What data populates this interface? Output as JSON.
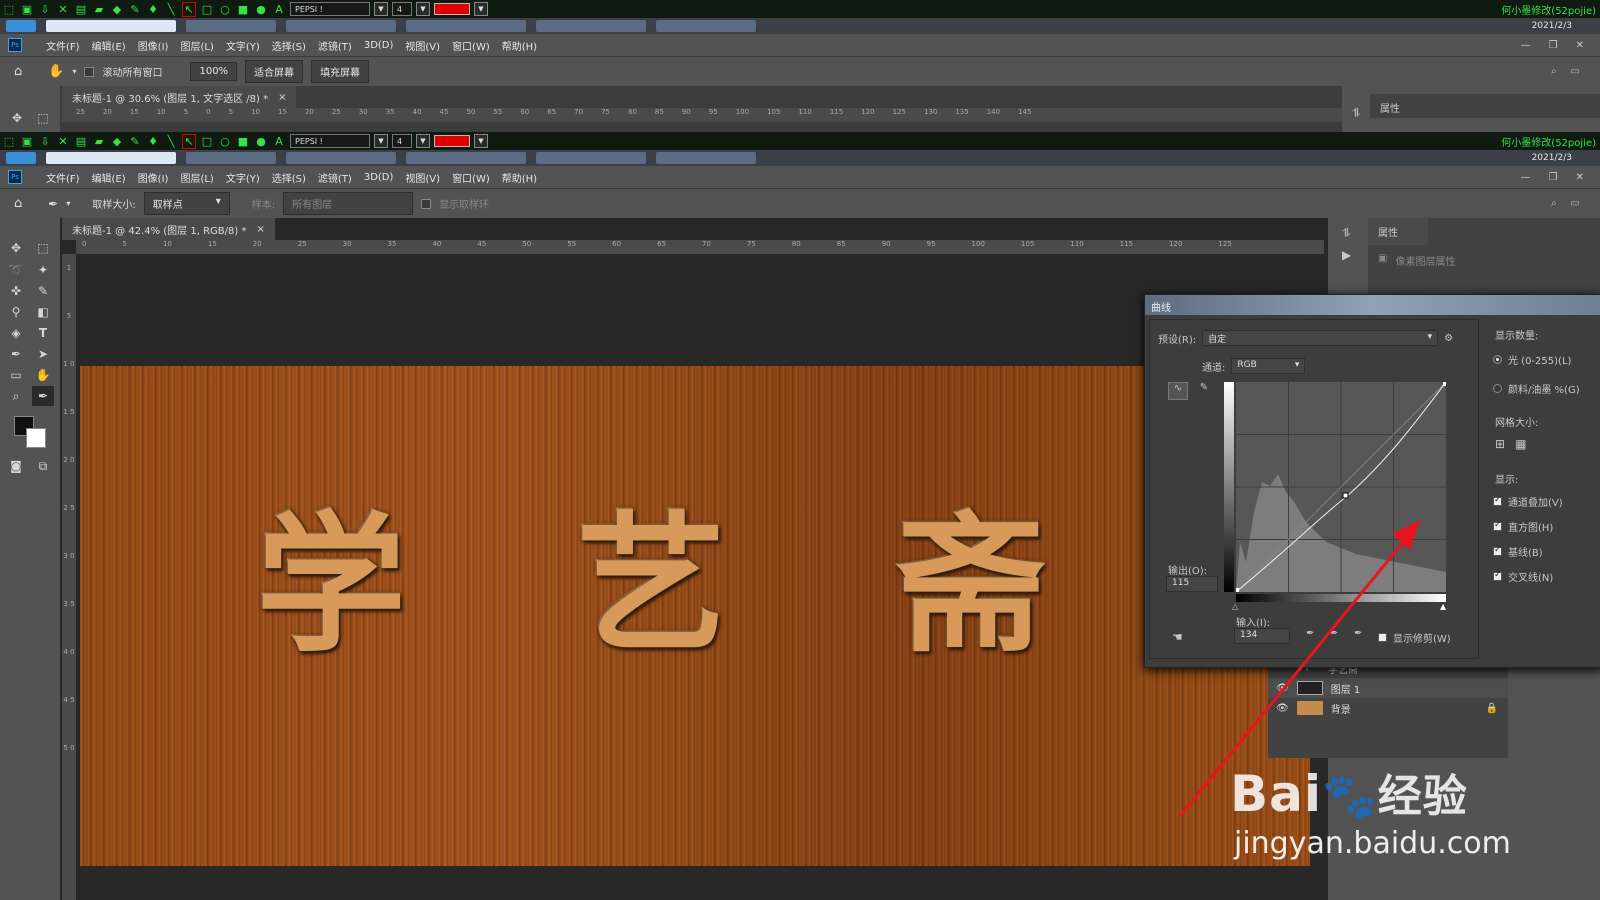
{
  "annotation_bar": {
    "font_select": "PEPSI !",
    "size_select": "4",
    "credit": "何小墨修改(52pojie)"
  },
  "taskbar": {
    "date": "2021/2/3"
  },
  "menu": {
    "items": [
      "文件(F)",
      "编辑(E)",
      "图像(I)",
      "图层(L)",
      "文字(Y)",
      "选择(S)",
      "滤镜(T)",
      "3D(D)",
      "视图(V)",
      "窗口(W)",
      "帮助(H)"
    ],
    "window_controls": [
      "—",
      "❐",
      "✕"
    ]
  },
  "top_instance": {
    "options": {
      "scroll_all_label": "滚动所有窗口",
      "zoom_btn": "100%",
      "fit_btn": "适合屏幕",
      "fill_btn": "填充屏幕"
    },
    "doc_tab": "未标题-1 @ 30.6% (图层 1, 文字选区 /8) *",
    "panel_title": "属性",
    "ruler_ticks": [
      "25",
      "20",
      "15",
      "10",
      "5",
      "0",
      "5",
      "10",
      "15",
      "20",
      "25",
      "30",
      "35",
      "40",
      "45",
      "50",
      "55",
      "60",
      "65",
      "70",
      "75",
      "80",
      "85",
      "90",
      "95",
      "100",
      "105",
      "110",
      "115",
      "120",
      "125",
      "130",
      "135",
      "140",
      "145"
    ]
  },
  "bottom_instance": {
    "options": {
      "sample_size_label": "取样大小:",
      "sample_size_value": "取样点",
      "sample_label": "样本:",
      "sample_value": "所有图层",
      "show_ring_label": "显示取样环"
    },
    "doc_tab": "未标题-1 @ 42.4% (图层 1, RGB/8) *",
    "ruler_ticks": [
      "0",
      "5",
      "10",
      "15",
      "20",
      "25",
      "30",
      "35",
      "40",
      "45",
      "50",
      "55",
      "60",
      "65",
      "70",
      "75",
      "80",
      "85",
      "90",
      "95",
      "100",
      "105",
      "110",
      "115",
      "120",
      "125"
    ],
    "vruler_ticks": [
      "1",
      "5",
      "1 0",
      "1 5",
      "2 0",
      "2 5",
      "3 0",
      "3 5",
      "4 0",
      "4 5",
      "5 0"
    ],
    "canvas_text": [
      "学",
      "艺",
      "斋"
    ],
    "panel_title": "属性",
    "panel_sub": "像素图层属性"
  },
  "curves": {
    "title": "曲线",
    "preset_label": "预设(R):",
    "preset_value": "自定",
    "channel_label": "通道:",
    "channel_value": "RGB",
    "output_label": "输出(O):",
    "output_value": "115",
    "input_label": "输入(I):",
    "input_value": "134",
    "show_clipping_label": "显示修剪(W)",
    "show_amount_label": "显示数量:",
    "light_label": "光 (0-255)(L)",
    "pigment_label": "颜料/油墨 %(G)",
    "grid_size_label": "网格大小:",
    "show_label": "显示:",
    "options": [
      {
        "label": "通道叠加(V)",
        "checked": true
      },
      {
        "label": "直方图(H)",
        "checked": true
      },
      {
        "label": "基线(B)",
        "checked": true
      },
      {
        "label": "交叉线(N)",
        "checked": true
      }
    ]
  },
  "layers": [
    {
      "name": "学艺斋",
      "type": "T"
    },
    {
      "name": "图层 1",
      "type": "pixel"
    },
    {
      "name": "背景",
      "type": "bg"
    }
  ],
  "watermark": {
    "brand": "Bai",
    "brand2": "经验",
    "url": "jingyan.baidu.com"
  },
  "colors": {
    "accent": "#31a8ff",
    "annotation_green": "#39e04a",
    "arrow_red": "#e8141e",
    "wood": "#c48a4e"
  }
}
